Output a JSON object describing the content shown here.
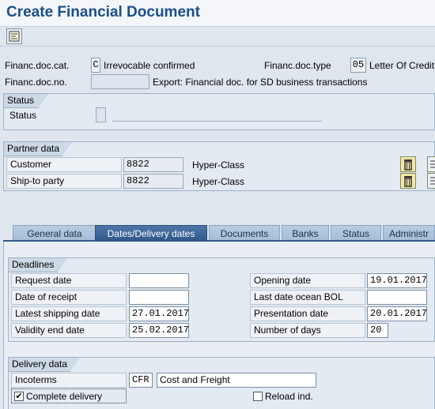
{
  "window": {
    "title": "Create Financial Document"
  },
  "toolbar": {
    "icon": "document-overview-icon"
  },
  "header": {
    "doc_cat_label": "Financ.doc.cat.",
    "doc_cat_value": "C",
    "doc_cat_text": "Irrevocable confirmed",
    "doc_type_label": "Financ.doc.type",
    "doc_type_value": "05",
    "doc_type_text": "Letter Of Credit",
    "doc_no_label": "Financ.doc.no.",
    "doc_no_value": "",
    "doc_no_text": "Export: Financial doc. for SD business transactions"
  },
  "status_group": {
    "title": "Status",
    "label": "Status",
    "value": "",
    "text": ""
  },
  "partner_group": {
    "title": "Partner data",
    "rows": [
      {
        "label": "Customer",
        "value": "8822",
        "name": "Hyper-Class"
      },
      {
        "label": "Ship-to party",
        "value": "8822",
        "name": "Hyper-Class"
      }
    ]
  },
  "tabs": [
    {
      "label": "General data"
    },
    {
      "label": "Dates/Delivery dates",
      "active": true
    },
    {
      "label": "Documents"
    },
    {
      "label": "Banks"
    },
    {
      "label": "Status"
    },
    {
      "label": "Administr"
    }
  ],
  "deadlines": {
    "title": "Deadlines",
    "left": [
      {
        "label": "Request date",
        "value": ""
      },
      {
        "label": "Date of receipt",
        "value": ""
      },
      {
        "label": "Latest shipping date",
        "value": "27.01.2017"
      },
      {
        "label": "Validity end date",
        "value": "25.02.2017"
      }
    ],
    "right": [
      {
        "label": "Opening date",
        "value": "19.01.2017"
      },
      {
        "label": "Last date ocean BOL",
        "value": ""
      },
      {
        "label": "Presentation date",
        "value": "20.01.2017"
      },
      {
        "label": "Number of days",
        "value": "20"
      }
    ]
  },
  "delivery": {
    "title": "Delivery data",
    "incoterms_label": "Incoterms",
    "incoterms_code": "CFR",
    "incoterms_text": "Cost and Freight",
    "complete_delivery_label": "Complete delivery",
    "complete_delivery_checked": true,
    "reload_label": "Reload ind.",
    "reload_checked": false
  },
  "colors": {
    "title": "#1a4f8a",
    "active_tab": "#30588a",
    "background": "#dfe6ee"
  }
}
